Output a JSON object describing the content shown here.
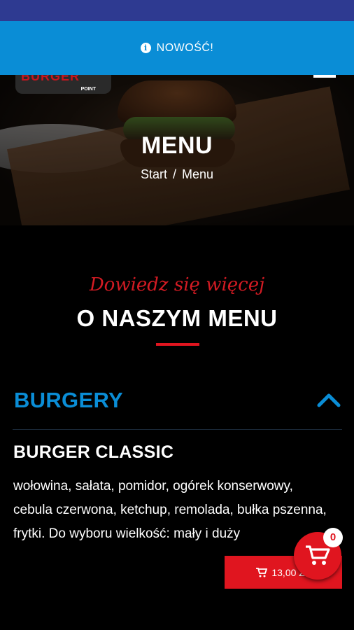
{
  "notice": {
    "icon": "info-icon",
    "text": "NOWOŚĆ!"
  },
  "hero": {
    "title": "MENU",
    "breadcrumb": [
      "Start",
      "Menu"
    ],
    "separator": "/",
    "logo_text": "BURGER",
    "logo_sub": "POINT"
  },
  "intro": {
    "script_text": "Dowiedz się więcej",
    "title": "O NASZYM MENU"
  },
  "category": {
    "name": "BURGERY",
    "expanded": true
  },
  "item": {
    "name": "BURGER CLASSIC",
    "description": "wołowina, sałata, pomidor, ogórek konserwowy, cebula czerwona, ketchup, remolada, bułka pszenna, frytki. Do wyboru wielkość: mały i duży",
    "price": "13,00 ZŁ"
  },
  "cart": {
    "count": "0"
  },
  "colors": {
    "status_bar": "#2e3a91",
    "notice_bar": "#0a8dd6",
    "accent_red": "#e0151f",
    "category_blue": "#0a8dd6"
  }
}
